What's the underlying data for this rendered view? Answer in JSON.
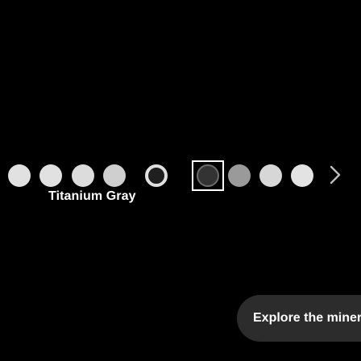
{
  "colors": {
    "swatches": [
      {
        "name": "swatch-1",
        "color": "#e1e1e1"
      },
      {
        "name": "swatch-2",
        "color": "#e1e1e1"
      },
      {
        "name": "swatch-3",
        "color": "#dcdcdc"
      },
      {
        "name": "swatch-4",
        "color": "#cfcfcf"
      },
      {
        "name": "swatch-5-selected",
        "color": "#333333"
      },
      {
        "name": "swatch-6",
        "color": "#9a9a9a"
      },
      {
        "name": "swatch-7",
        "color": "#d7d7d7"
      },
      {
        "name": "swatch-8",
        "color": "#e3e3e3"
      }
    ],
    "selection_border": "#ffffff",
    "background": "#000000",
    "pill_background": "#2c2c2c"
  },
  "selected_color_name": "Titanium Gray",
  "explore_label": "Explore the mineral",
  "icons": {
    "next": "chevron-right-icon"
  }
}
